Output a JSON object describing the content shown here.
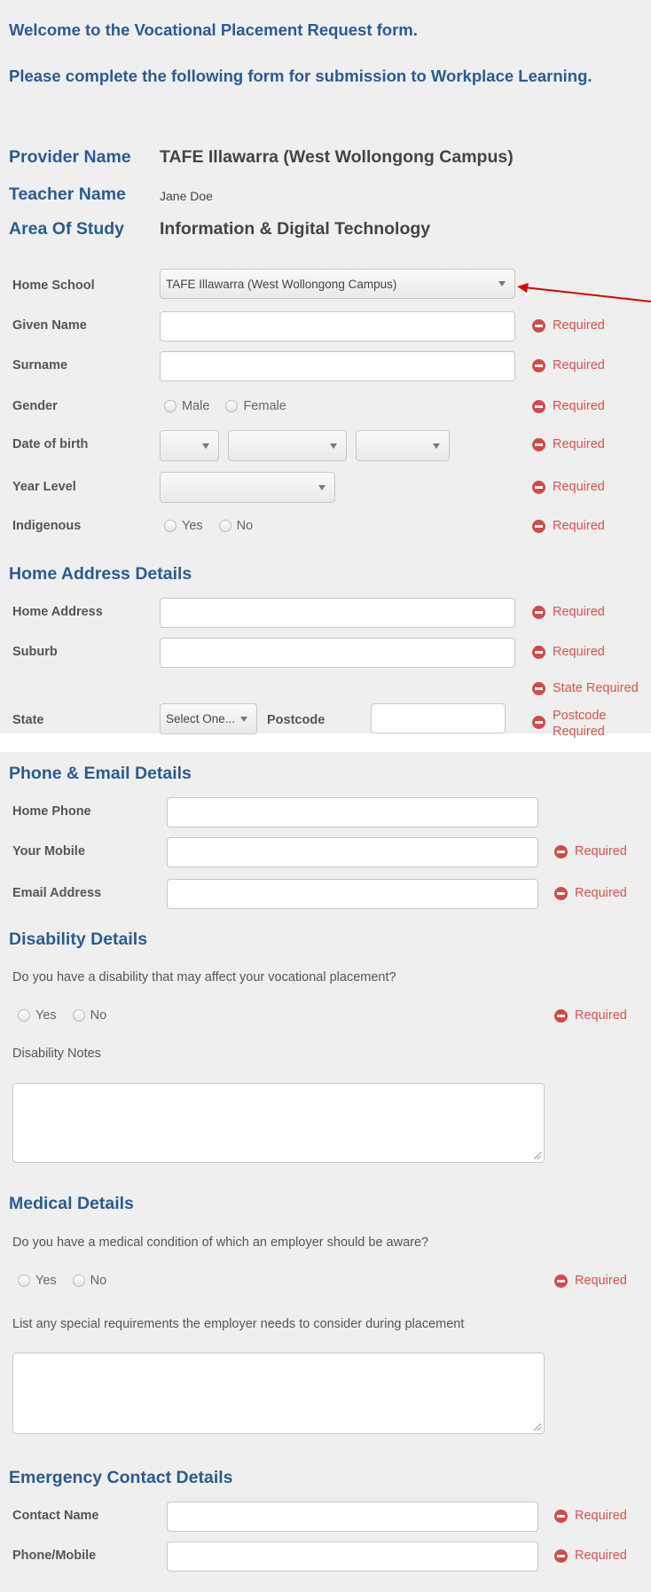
{
  "welcome": {
    "line1": "Welcome to the Vocational Placement Request form.",
    "line2": "Please complete the following form for submission to Workplace Learning."
  },
  "info": {
    "provider_label": "Provider Name",
    "provider_value": "TAFE Illawarra (West Wollongong Campus)",
    "teacher_label": "Teacher Name",
    "teacher_value": "Jane Doe",
    "area_label": "Area Of Study",
    "area_value": "Information & Digital Technology"
  },
  "personal": {
    "home_school_label": "Home School",
    "home_school_value": "TAFE Illawarra (West Wollongong Campus)",
    "given_name_label": "Given Name",
    "surname_label": "Surname",
    "gender_label": "Gender",
    "gender_options": [
      "Male",
      "Female"
    ],
    "dob_label": "Date of birth",
    "year_level_label": "Year Level",
    "indigenous_label": "Indigenous",
    "indigenous_options": [
      "Yes",
      "No"
    ]
  },
  "home_address": {
    "heading": "Home Address Details",
    "address_label": "Home Address",
    "suburb_label": "Suburb",
    "state_label": "State",
    "state_value": "Select One...",
    "postcode_label": "Postcode",
    "state_required": "State Required",
    "postcode_required": "Postcode Required"
  },
  "phone_email": {
    "heading": "Phone & Email Details",
    "home_phone_label": "Home Phone",
    "mobile_label": "Your Mobile",
    "email_label": "Email Address"
  },
  "disability": {
    "heading": "Disability Details",
    "question": "Do you have a disability that may affect your vocational placement?",
    "options": [
      "Yes",
      "No"
    ],
    "notes_label": "Disability Notes"
  },
  "medical": {
    "heading": "Medical Details",
    "question": "Do you have a medical condition of which an employer should be aware?",
    "options": [
      "Yes",
      "No"
    ],
    "requirements_label": "List any special requirements the employer needs to consider during placement"
  },
  "emergency": {
    "heading": "Emergency Contact Details",
    "contact_name_label": "Contact Name",
    "phone_label": "Phone/Mobile"
  },
  "validation": {
    "required": "Required"
  },
  "colors": {
    "heading_blue": "#2d5a8f",
    "required_red": "#d9534f",
    "arrow_red": "#e00000"
  }
}
